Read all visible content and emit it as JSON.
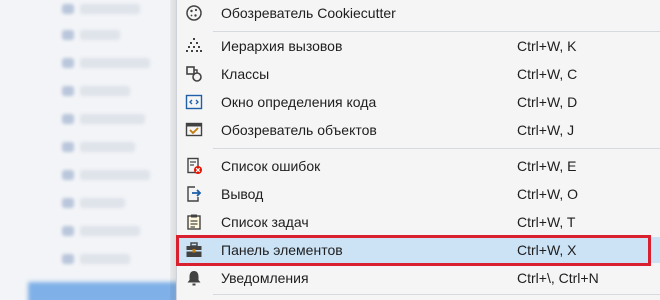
{
  "menu": {
    "items": [
      {
        "label": "Обозреватель Cookiecutter",
        "shortcut": "",
        "icon": "cookiecutter-icon"
      },
      {
        "label": "Иерархия вызовов",
        "shortcut": "Ctrl+W, K",
        "icon": "call-hierarchy-icon"
      },
      {
        "label": "Классы",
        "shortcut": "Ctrl+W, C",
        "icon": "class-view-icon"
      },
      {
        "label": "Окно определения кода",
        "shortcut": "Ctrl+W, D",
        "icon": "code-definition-icon"
      },
      {
        "label": "Обозреватель объектов",
        "shortcut": "Ctrl+W, J",
        "icon": "object-browser-icon"
      },
      {
        "label": "Список ошибок",
        "shortcut": "Ctrl+W, E",
        "icon": "error-list-icon"
      },
      {
        "label": "Вывод",
        "shortcut": "Ctrl+W, O",
        "icon": "output-icon"
      },
      {
        "label": "Список задач",
        "shortcut": "Ctrl+W, T",
        "icon": "task-list-icon"
      },
      {
        "label": "Панель элементов",
        "shortcut": "Ctrl+W, X",
        "icon": "toolbox-icon"
      },
      {
        "label": "Уведомления",
        "shortcut": "Ctrl+\\, Ctrl+N",
        "icon": "notifications-icon"
      }
    ],
    "highlight_color": "#d9202f",
    "selected_bg": "#cce3f6"
  }
}
